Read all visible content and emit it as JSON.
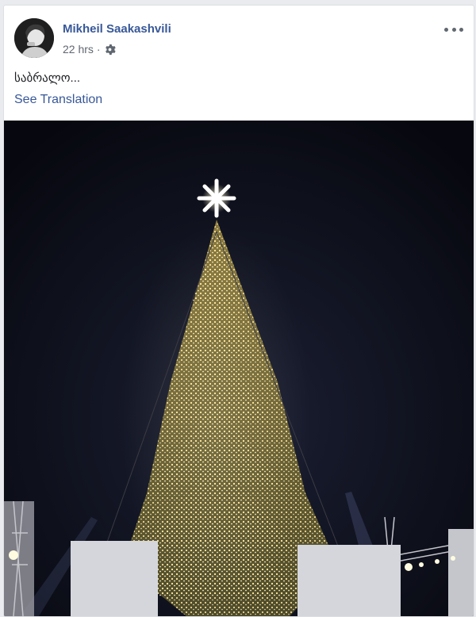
{
  "post": {
    "author": {
      "name": "Mikheil Saakashvili",
      "avatar_icon": "profile-photo"
    },
    "meta": {
      "time": "22 hrs",
      "separator": "·",
      "privacy_icon": "gear-icon"
    },
    "more_icon": "ellipsis-icon",
    "text": "საბრალო...",
    "see_translation": "See Translation",
    "photo": {
      "alt_subject": "Christmas tree with lights at night"
    }
  },
  "colors": {
    "link": "#385898",
    "meta": "#616770",
    "text": "#1c1e21",
    "photo_sky": "#0b0d1c",
    "lights": "#f3d27a"
  }
}
